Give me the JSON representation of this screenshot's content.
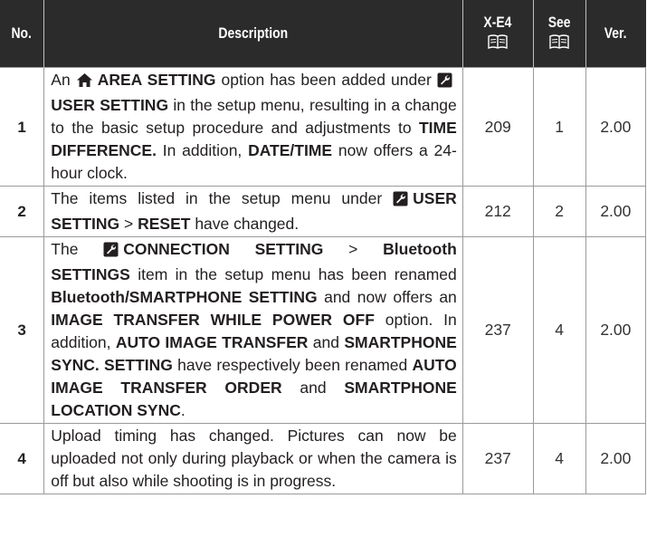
{
  "headers": {
    "no": "No.",
    "description": "Description",
    "model": "X-E4",
    "see": "See",
    "ver": "Ver."
  },
  "rows": [
    {
      "no": "1",
      "desc": [
        {
          "t": "An ",
          "b": false
        },
        {
          "icon": "home-icon"
        },
        {
          "t": "AREA SETTING",
          "b": true
        },
        {
          "t": " option has been added under ",
          "b": false
        },
        {
          "icon": "wrench-icon"
        },
        {
          "t": "USER SETTING",
          "b": true
        },
        {
          "t": " in the setup menu, resulting in a change to the basic setup procedure and adjustments to ",
          "b": false
        },
        {
          "t": "TIME DIFFERENCE.",
          "b": true
        },
        {
          "t": " In addition, ",
          "b": false
        },
        {
          "t": "DATE/TIME",
          "b": true
        },
        {
          "t": " now offers a 24-hour clock.",
          "b": false
        }
      ],
      "page": "209",
      "see": "1",
      "ver": "2.00"
    },
    {
      "no": "2",
      "desc": [
        {
          "t": "The items listed in the setup menu under ",
          "b": false
        },
        {
          "icon": "wrench-icon"
        },
        {
          "t": "USER SETTING",
          "b": true
        },
        {
          "t": " > ",
          "b": false
        },
        {
          "t": "RESET",
          "b": true
        },
        {
          "t": " have changed.",
          "b": false
        }
      ],
      "page": "212",
      "see": "2",
      "ver": "2.00"
    },
    {
      "no": "3",
      "desc": [
        {
          "t": "The ",
          "b": false
        },
        {
          "icon": "wrench-icon"
        },
        {
          "t": "CONNECTION SETTING",
          "b": true
        },
        {
          "t": " > ",
          "b": false
        },
        {
          "t": "Bluetooth SETTINGS",
          "b": true
        },
        {
          "t": " item in the setup menu has been renamed ",
          "b": false
        },
        {
          "t": "Bluetooth/SMARTPHONE SETTING",
          "b": true
        },
        {
          "t": " and now offers an ",
          "b": false
        },
        {
          "t": "IMAGE TRANSFER WHILE POWER OFF",
          "b": true
        },
        {
          "t": " option. In addition, ",
          "b": false
        },
        {
          "t": "AUTO IMAGE TRANSFER",
          "b": true
        },
        {
          "t": " and ",
          "b": false
        },
        {
          "t": "SMARTPHONE SYNC. SETTING",
          "b": true
        },
        {
          "t": " have respectively been renamed ",
          "b": false
        },
        {
          "t": "AUTO IMAGE TRANSFER ORDER",
          "b": true
        },
        {
          "t": " and ",
          "b": false
        },
        {
          "t": "SMARTPHONE LOCATION SYNC",
          "b": true
        },
        {
          "t": ".",
          "b": false
        }
      ],
      "page": "237",
      "see": "4",
      "ver": "2.00"
    },
    {
      "no": "4",
      "desc": [
        {
          "t": "Upload timing has changed. Pictures can now be uploaded not only during playback or when the camera is off but also while shooting is in progress.",
          "b": false
        }
      ],
      "page": "237",
      "see": "4",
      "ver": "2.00"
    }
  ],
  "colors": {
    "header_bg": "#2b2b2b",
    "header_text": "#ffffff",
    "rule": "#9a9a9a"
  }
}
